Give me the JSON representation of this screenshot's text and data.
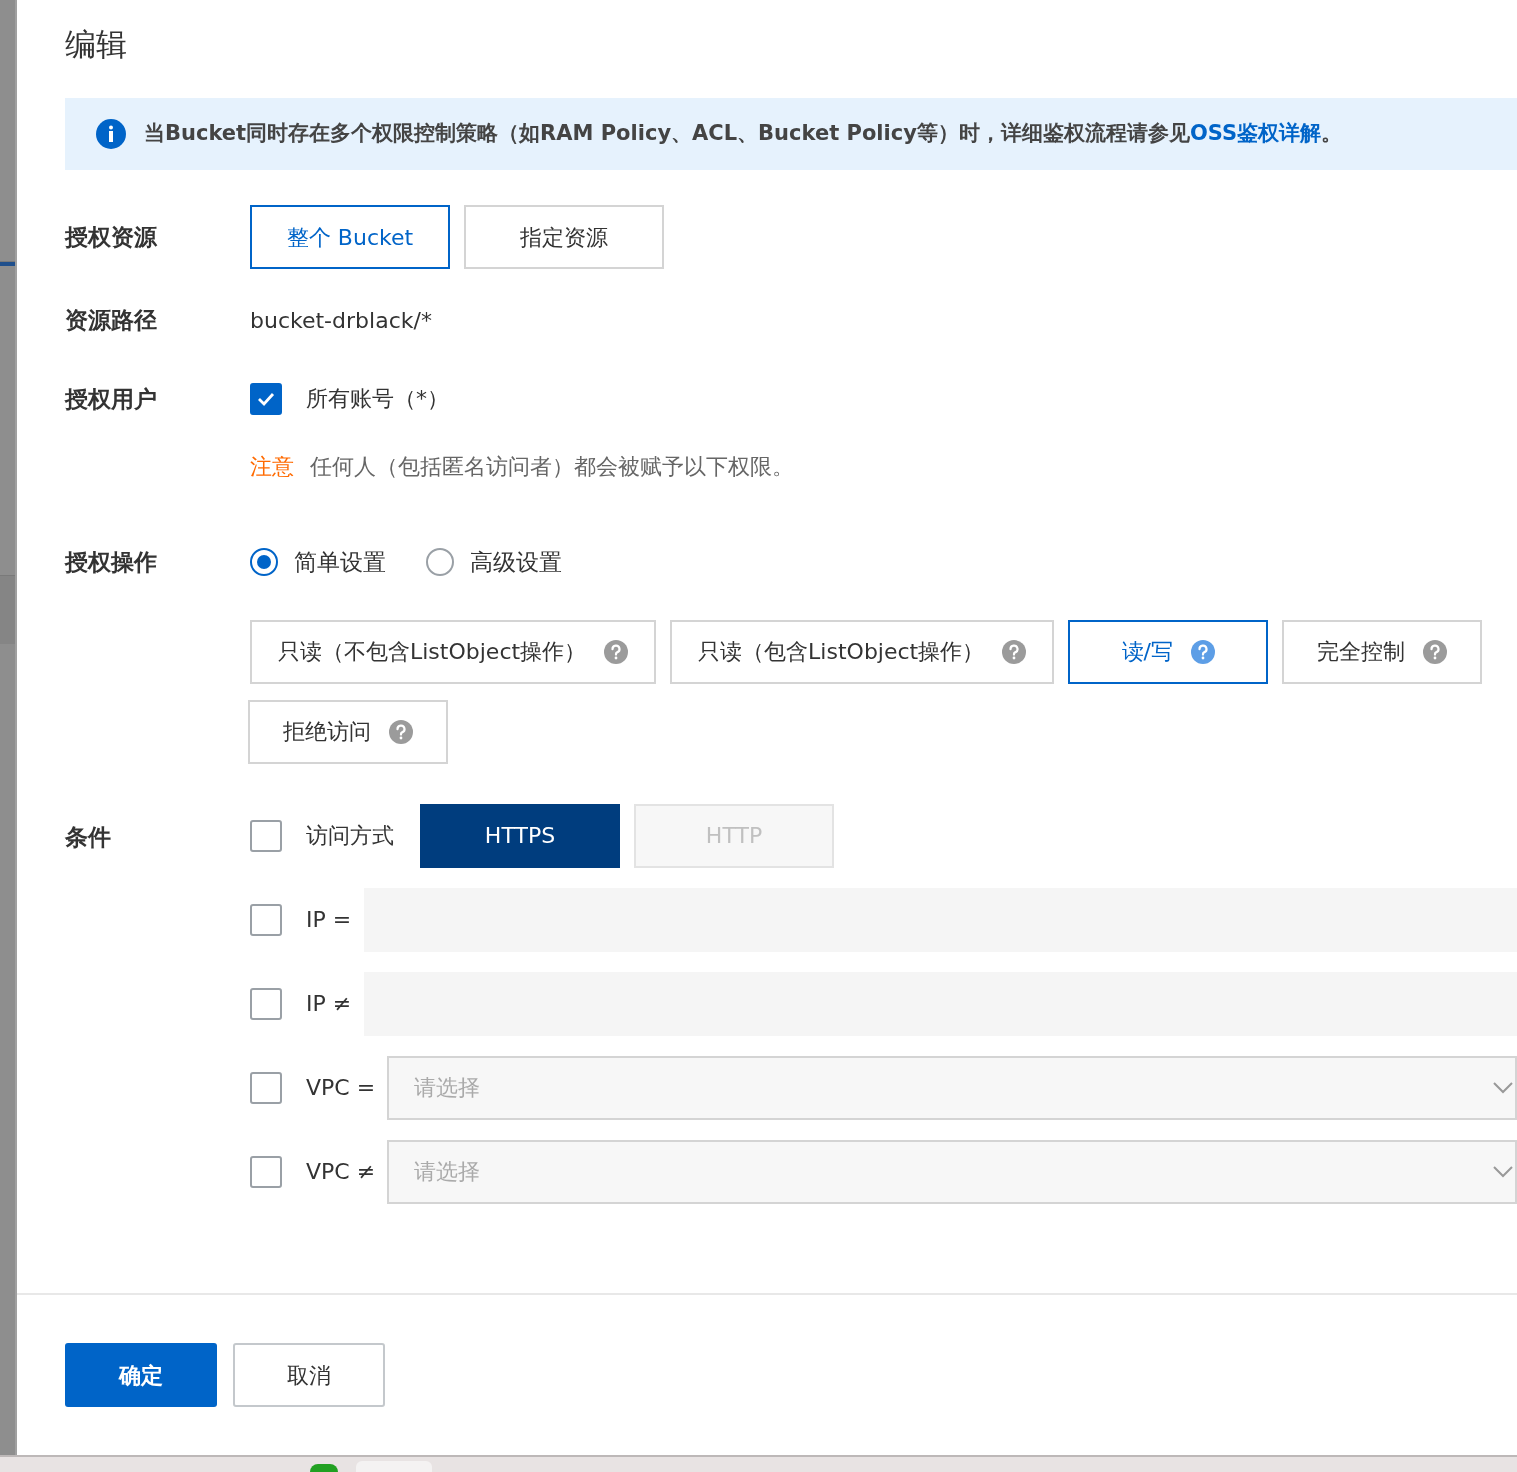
{
  "dialog": {
    "title": "编辑"
  },
  "notice": {
    "text": "当Bucket同时存在多个权限控制策略（如RAM Policy、ACL、Bucket Policy等）时，详细鉴权流程请参见",
    "link": "OSS鉴权详解",
    "end": "。"
  },
  "resource": {
    "label": "授权资源",
    "options": [
      {
        "label": "整个 Bucket",
        "selected": true
      },
      {
        "label": "指定资源",
        "selected": false
      }
    ]
  },
  "path": {
    "label": "资源路径",
    "value": "bucket-drblack/*"
  },
  "users": {
    "label": "授权用户",
    "checkbox": {
      "label": "所有账号（*）",
      "checked": true
    },
    "note_tag": "注意",
    "note": "任何人（包括匿名访问者）都会被赋予以下权限。"
  },
  "actions": {
    "label": "授权操作",
    "modes": [
      {
        "label": "简单设置",
        "selected": true
      },
      {
        "label": "高级设置",
        "selected": false
      }
    ],
    "options": [
      {
        "label": "只读（不包含ListObject操作）",
        "selected": false
      },
      {
        "label": "只读（包含ListObject操作）",
        "selected": false
      },
      {
        "label": "读/写",
        "selected": true
      },
      {
        "label": "完全控制",
        "selected": false
      },
      {
        "label": "拒绝访问",
        "selected": false
      }
    ]
  },
  "conditions": {
    "label": "条件",
    "items": [
      {
        "kind": "toggle",
        "label": "访问方式",
        "checked": false,
        "options": [
          {
            "label": "HTTPS",
            "selected": true
          },
          {
            "label": "HTTP",
            "selected": false
          }
        ]
      },
      {
        "kind": "input",
        "label": "IP =",
        "checked": false
      },
      {
        "kind": "input",
        "label": "IP ≠",
        "checked": false
      },
      {
        "kind": "select",
        "label": "VPC =",
        "checked": false,
        "placeholder": "请选择"
      },
      {
        "kind": "select",
        "label": "VPC ≠",
        "checked": false,
        "placeholder": "请选择"
      }
    ]
  },
  "footer": {
    "confirm": "确定",
    "cancel": "取消"
  }
}
